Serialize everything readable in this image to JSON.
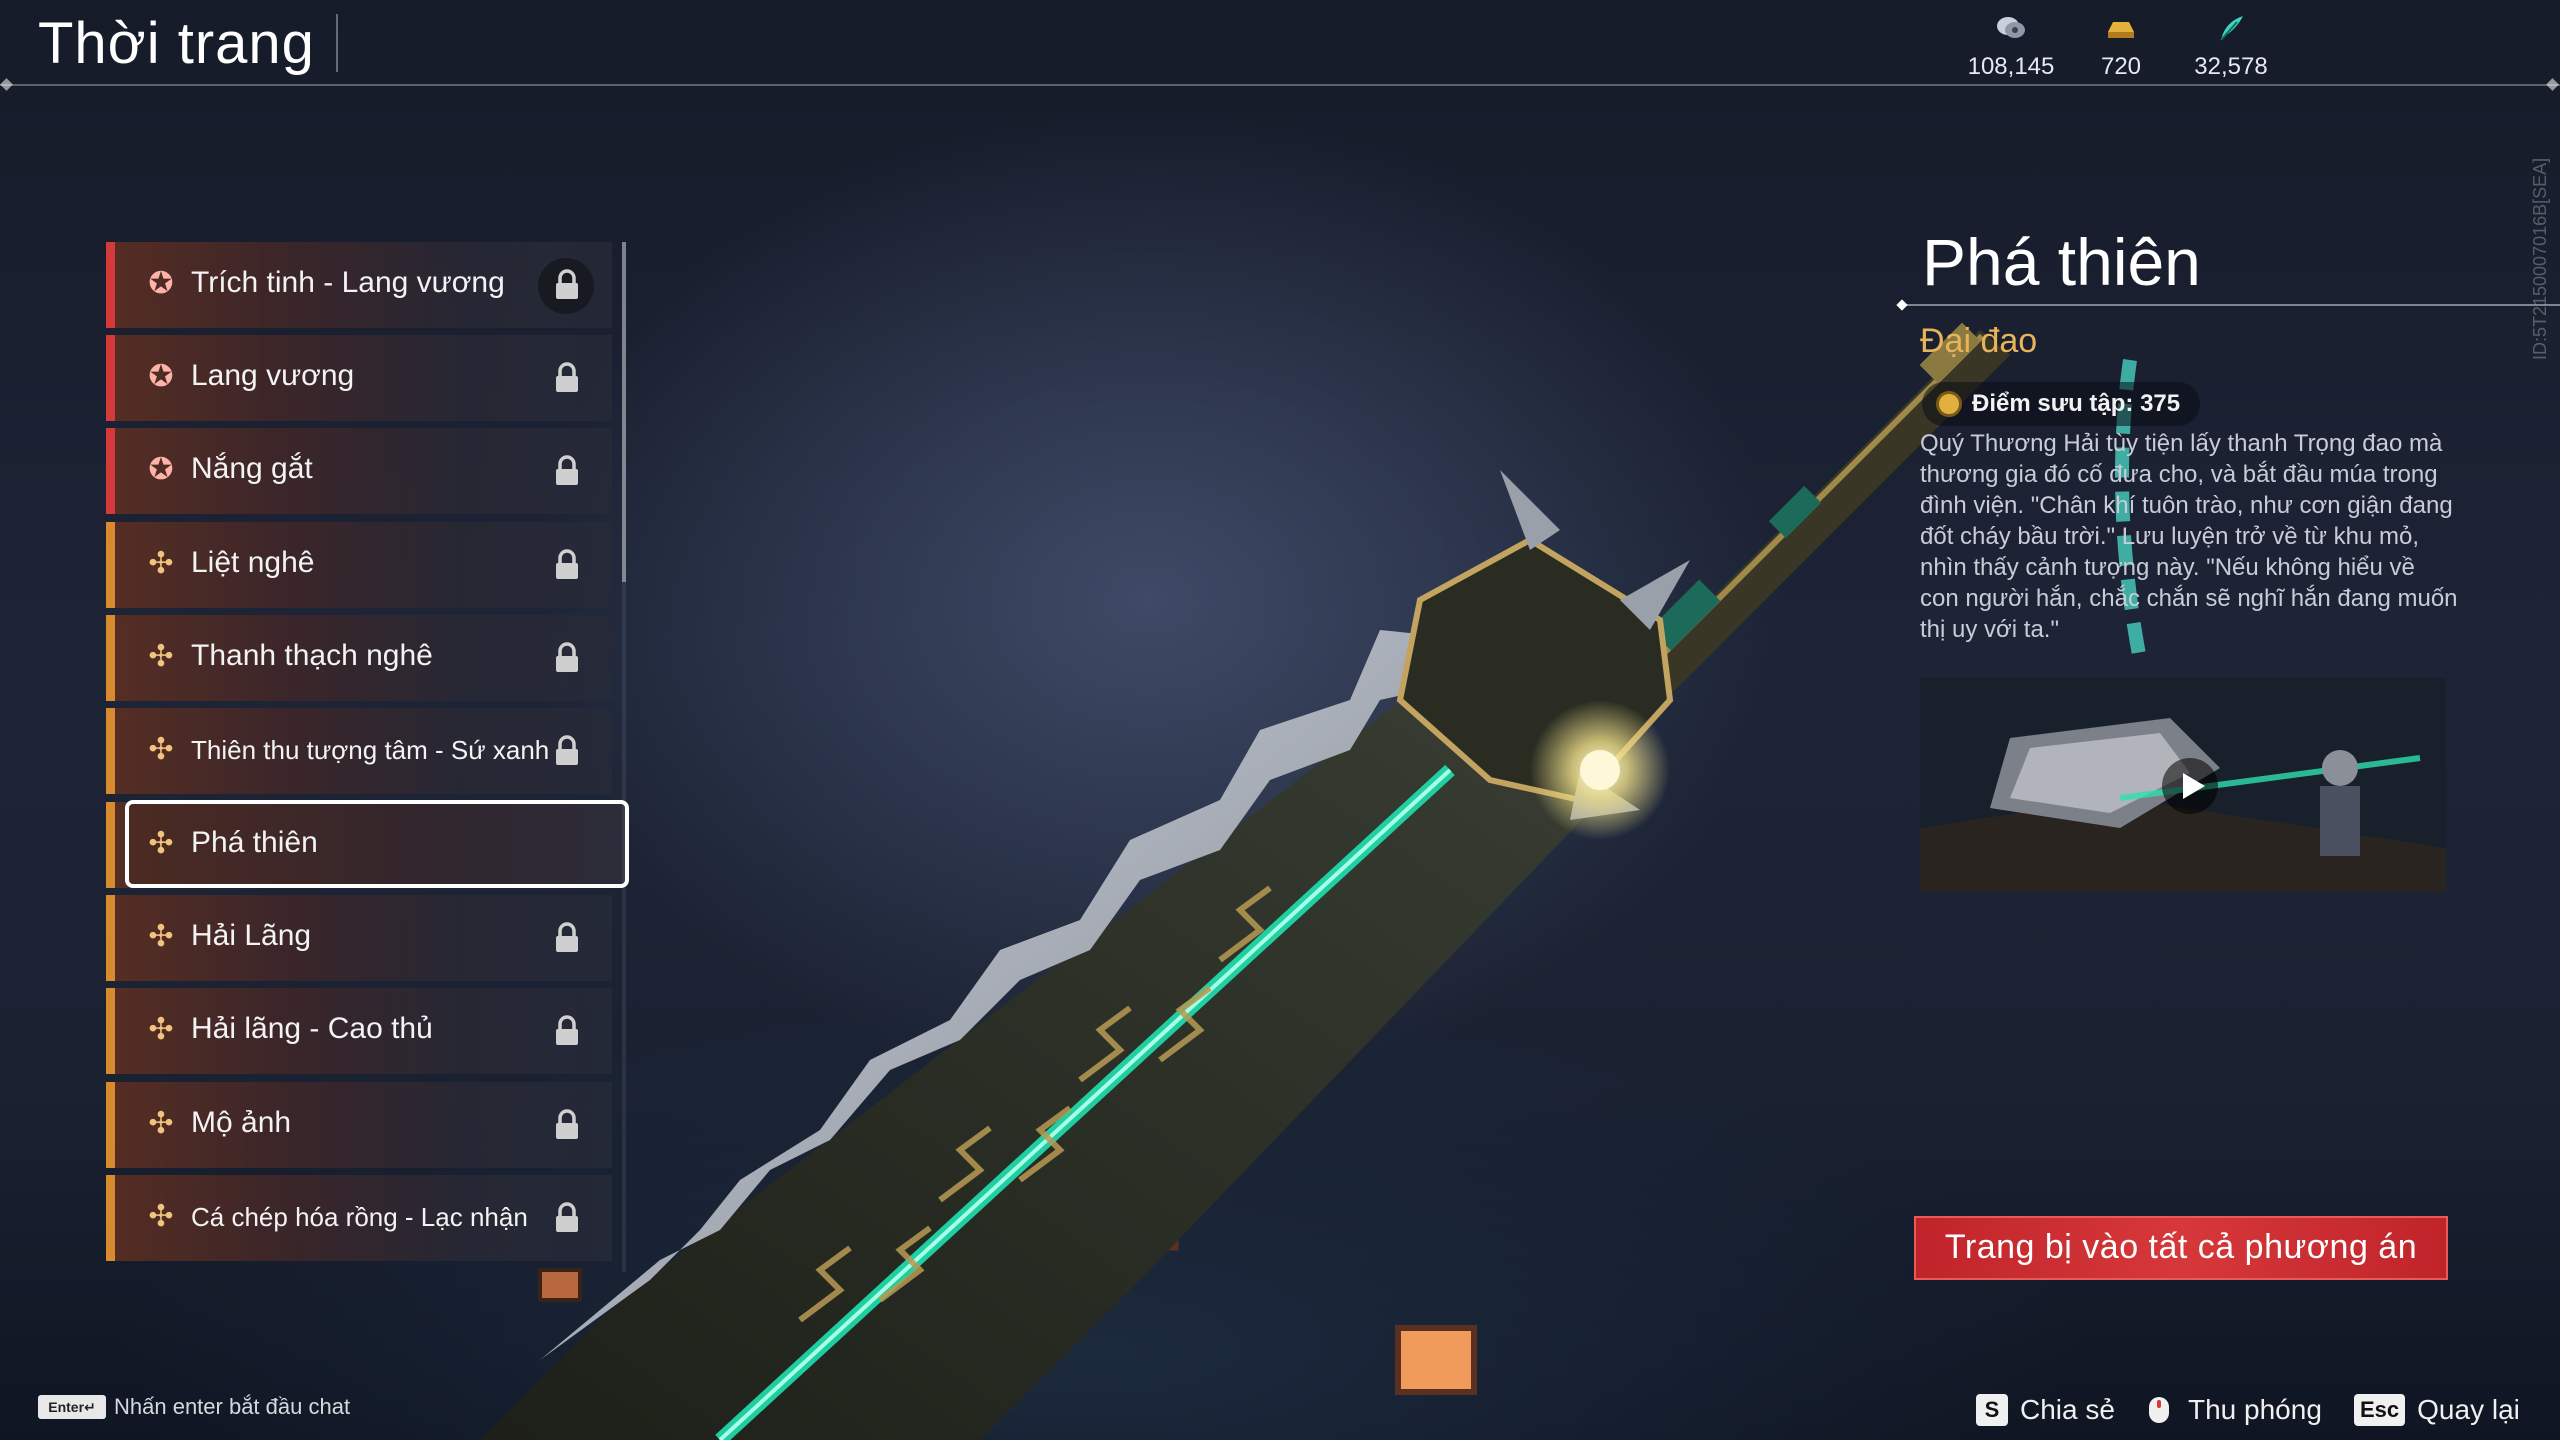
{
  "header": {
    "title": "Thời trang",
    "currencies": [
      {
        "icon": "silver-coin-icon",
        "value": "108,145",
        "color": "#b9c2d0"
      },
      {
        "icon": "gold-ingot-icon",
        "value": "720",
        "color": "#e3b23c"
      },
      {
        "icon": "jade-feather-icon",
        "value": "32,578",
        "color": "#3fd3c3"
      }
    ],
    "side_id": "ID:5T2150007016B[SEA]"
  },
  "list": {
    "items": [
      {
        "label": "Trích tinh - Lang vương",
        "rank": "red",
        "locked": true
      },
      {
        "label": "Lang vương",
        "rank": "red",
        "locked": true
      },
      {
        "label": "Nắng gắt",
        "rank": "red",
        "locked": true
      },
      {
        "label": "Liệt nghê",
        "rank": "orange",
        "locked": true
      },
      {
        "label": "Thanh thạch nghê",
        "rank": "orange",
        "locked": true
      },
      {
        "label": "Thiên thu tượng tâm - Sứ xanh",
        "rank": "orange",
        "locked": true
      },
      {
        "label": "Phá thiên",
        "rank": "orange",
        "locked": false,
        "selected": true
      },
      {
        "label": "Hải Lãng",
        "rank": "orange",
        "locked": true
      },
      {
        "label": "Hải lãng - Cao thủ",
        "rank": "orange",
        "locked": true
      },
      {
        "label": "Mộ ảnh",
        "rank": "orange",
        "locked": true
      },
      {
        "label": "Cá chép hóa rồng - Lạc nhận",
        "rank": "orange",
        "locked": true
      }
    ]
  },
  "detail": {
    "name": "Phá thiên",
    "type": "Đại đao",
    "points": "Điểm sưu tập: 375",
    "description": "Quý Thương Hải tùy tiện lấy thanh Trọng đao mà thương gia đó cố đưa cho, và bắt đầu múa trong đình viện. \"Chân khí tuôn trào, như cơn giận đang đốt cháy bầu trời.\" Lưu luyện trở về từ khu mỏ, nhìn thấy cảnh tượng này. \"Nếu không hiểu về con người hắn, chắc chắn sẽ nghĩ hắn đang muốn thị uy với ta.\"",
    "equip_button": "Trang bị vào tất cả phương án"
  },
  "footer": {
    "chat_key": "Enter↵",
    "chat_hint": "Nhấn enter bắt đầu chat",
    "share_key": "S",
    "share_label": "Chia sẻ",
    "zoom_label": "Thu phóng",
    "back_key": "Esc",
    "back_label": "Quay lại"
  }
}
